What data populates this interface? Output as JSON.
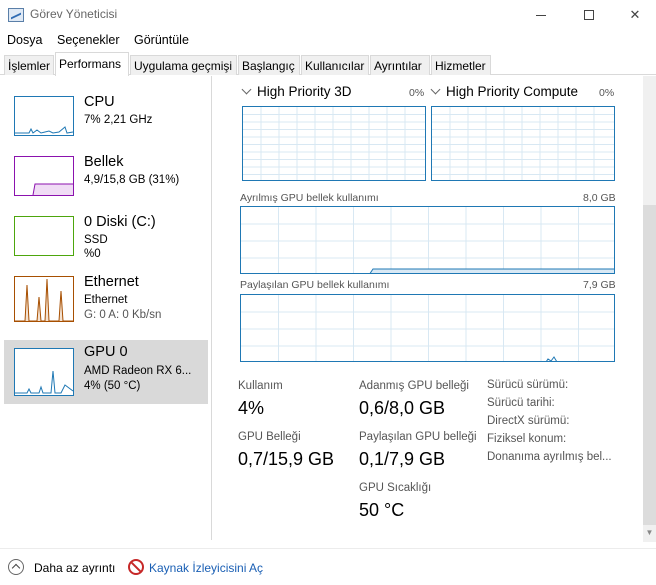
{
  "window": {
    "title": "Görev Yöneticisi",
    "min_glyph": "",
    "close_glyph": "✕"
  },
  "menu": [
    "Dosya",
    "Seçenekler",
    "Görüntüle"
  ],
  "tabs": [
    {
      "label": "İşlemler",
      "active": false
    },
    {
      "label": "Performans",
      "active": true
    },
    {
      "label": "Uygulama geçmişi",
      "active": false
    },
    {
      "label": "Başlangıç",
      "active": false
    },
    {
      "label": "Kullanıcılar",
      "active": false
    },
    {
      "label": "Ayrıntılar",
      "active": false
    },
    {
      "label": "Hizmetler",
      "active": false
    }
  ],
  "resources": [
    {
      "name": "CPU",
      "line1": "7% 2,21 GHz",
      "line2": "",
      "color": "#1f78b4",
      "selected": false
    },
    {
      "name": "Bellek",
      "line1": "4,9/15,8 GB (31%)",
      "line2": "",
      "color": "#8b12ae",
      "selected": false
    },
    {
      "name": "0 Diski (C:)",
      "line1": "SSD",
      "line2": "%0",
      "color": "#4da60c",
      "selected": false
    },
    {
      "name": "Ethernet",
      "line1": "Ethernet",
      "line2": "G: 0 A: 0 Kb/sn",
      "color": "#a74f01",
      "selected": false
    },
    {
      "name": "GPU 0",
      "line1": "AMD Radeon RX 6...",
      "line2": "4% (50 °C)",
      "color": "#1f78b4",
      "selected": true
    }
  ],
  "gpu": {
    "engines": [
      {
        "label": "High Priority 3D",
        "pct": "0%"
      },
      {
        "label": "High Priority Compute",
        "pct": "0%"
      }
    ],
    "dedicated_graph": {
      "label": "Ayrılmış GPU bellek kullanımı",
      "max": "8,0 GB"
    },
    "shared_graph": {
      "label": "Paylaşılan GPU bellek kullanımı",
      "max": "7,9 GB"
    },
    "stats": {
      "usage_label": "Kullanım",
      "usage_value": "4%",
      "gpu_memory_label": "GPU Belleği",
      "gpu_memory_value": "0,7/15,9 GB",
      "dedicated_label": "Adanmış GPU belleği",
      "dedicated_value": "0,6/8,0 GB",
      "shared_label": "Paylaşılan GPU belleği",
      "shared_value": "0,1/7,9 GB",
      "temp_label": "GPU Sıcaklığı",
      "temp_value": "50 °C"
    },
    "properties": [
      "Sürücü sürümü:",
      "Sürücü tarihi:",
      "DirectX sürümü:",
      "Fiziksel konum:",
      "Donanıma ayrılmış bel..."
    ]
  },
  "footer": {
    "fewer_details": "Daha az ayrıntı",
    "resource_monitor": "Kaynak İzleyicisini Aç"
  },
  "colors": {
    "gpu_graph": "#1f78b4",
    "cpu": "#1f78b4",
    "memory": "#8b12ae",
    "disk": "#4da60c",
    "ethernet": "#a74f01"
  }
}
